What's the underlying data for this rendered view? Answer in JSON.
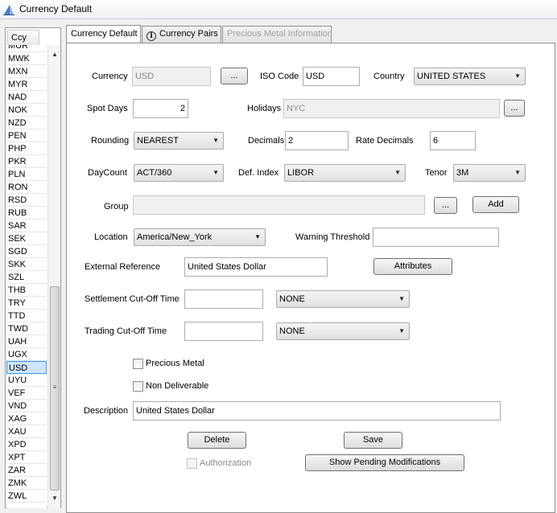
{
  "window": {
    "title": "Currency Default"
  },
  "currency_list": {
    "header": "Ccy",
    "items": [
      "MUR",
      "MWK",
      "MXN",
      "MYR",
      "NAD",
      "NOK",
      "NZD",
      "PEN",
      "PHP",
      "PKR",
      "PLN",
      "RON",
      "RSD",
      "RUB",
      "SAR",
      "SEK",
      "SGD",
      "SKK",
      "SZL",
      "THB",
      "TRY",
      "TTD",
      "TWD",
      "UAH",
      "UGX",
      "USD",
      "UYU",
      "VEF",
      "VND",
      "XAG",
      "XAU",
      "XPD",
      "XPT",
      "ZAR",
      "ZMK",
      "ZWL"
    ],
    "selected": "USD"
  },
  "tabs": [
    "Currency Default",
    "Currency Pairs",
    "Precious Metal Information"
  ],
  "form": {
    "currency": {
      "label": "Currency",
      "value": "USD",
      "browse": "..."
    },
    "iso_code": {
      "label": "ISO Code",
      "value": "USD"
    },
    "country": {
      "label": "Country",
      "value": "UNITED STATES"
    },
    "spot_days": {
      "label": "Spot Days",
      "value": "2"
    },
    "holidays": {
      "label": "Holidays",
      "value": "NYC",
      "browse": "..."
    },
    "rounding": {
      "label": "Rounding",
      "value": "NEAREST"
    },
    "decimals": {
      "label": "Decimals",
      "value": "2"
    },
    "rate_decimals": {
      "label": "Rate Decimals",
      "value": "6"
    },
    "daycount": {
      "label": "DayCount",
      "value": "ACT/360"
    },
    "def_index": {
      "label": "Def. Index",
      "value": "LIBOR"
    },
    "tenor": {
      "label": "Tenor",
      "value": "3M"
    },
    "group": {
      "label": "Group",
      "value": "",
      "browse": "...",
      "add": "Add"
    },
    "location": {
      "label": "Location",
      "value": "America/New_York"
    },
    "warning_threshold": {
      "label": "Warning Threshold",
      "value": ""
    },
    "external_reference": {
      "label": "External  Reference",
      "value": "United States Dollar"
    },
    "attributes_button": "Attributes",
    "settlement_cutoff": {
      "label": "Settlement Cut-Off Time",
      "value": "",
      "zone": "NONE"
    },
    "trading_cutoff": {
      "label": "Trading Cut-Off Time",
      "value": "",
      "zone": "NONE"
    },
    "precious_metal": {
      "label": "Precious Metal"
    },
    "non_deliverable": {
      "label": "Non Deliverable"
    },
    "description": {
      "label": "Description",
      "value": "United States Dollar"
    },
    "delete_button": "Delete",
    "save_button": "Save",
    "authorization": {
      "label": "Authorization"
    },
    "show_pending_button": "Show Pending Modifications"
  }
}
